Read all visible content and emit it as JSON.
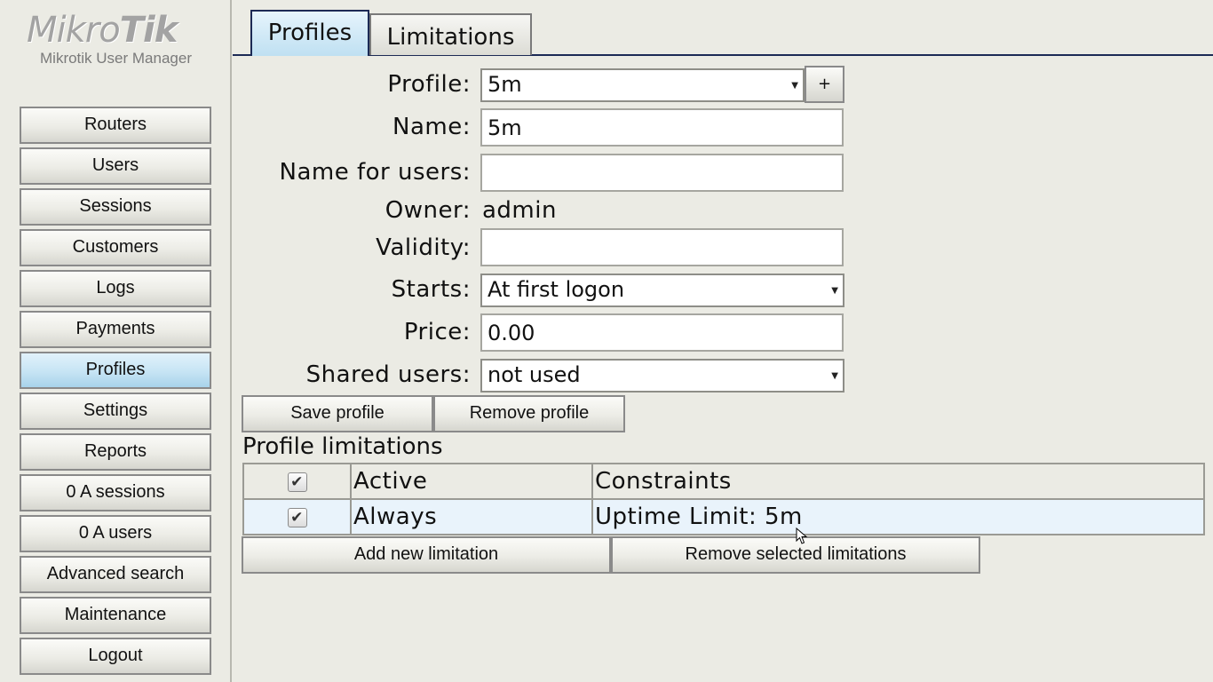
{
  "app": {
    "logo_text_a": "Mikro",
    "logo_text_b": "Tik",
    "subtitle": "Mikrotik User Manager"
  },
  "sidebar": {
    "items": [
      {
        "label": "Routers"
      },
      {
        "label": "Users"
      },
      {
        "label": "Sessions"
      },
      {
        "label": "Customers"
      },
      {
        "label": "Logs"
      },
      {
        "label": "Payments"
      },
      {
        "label": "Profiles",
        "active": true
      },
      {
        "label": "Settings"
      },
      {
        "label": "Reports"
      },
      {
        "label": "0 A sessions"
      },
      {
        "label": "0 A users"
      },
      {
        "label": "Advanced search"
      },
      {
        "label": "Maintenance"
      },
      {
        "label": "Logout"
      }
    ]
  },
  "tabs": [
    {
      "label": "Profiles",
      "active": true
    },
    {
      "label": "Limitations",
      "active": false
    }
  ],
  "form": {
    "profile_label": "Profile:",
    "profile_value": "5m",
    "add_label": "+",
    "name_label": "Name:",
    "name_value": "5m",
    "name_for_users_label": "Name for users:",
    "name_for_users_value": "",
    "owner_label": "Owner:",
    "owner_value": "admin",
    "validity_label": "Validity:",
    "validity_value": "",
    "starts_label": "Starts:",
    "starts_value": "At first logon",
    "price_label": "Price:",
    "price_value": "0.00",
    "shared_users_label": "Shared users:",
    "shared_users_value": "not used",
    "save_label": "Save profile",
    "remove_label": "Remove profile"
  },
  "limitations": {
    "title": "Profile limitations",
    "columns": [
      "",
      "Active",
      "Constraints"
    ],
    "header_checked": true,
    "rows": [
      {
        "checked": true,
        "active": "Always",
        "constraints": "Uptime Limit: 5m"
      }
    ],
    "add_label": "Add new limitation",
    "remove_label": "Remove selected limitations"
  },
  "icons": {
    "checkmark": "checkmark-icon",
    "dropdown": "dropdown-arrow-icon",
    "cursor": "mouse-cursor-icon"
  },
  "colors": {
    "background": "#ebebe4",
    "active_button": "#c6e4f4",
    "tab_line": "#1c2a55",
    "selected_row": "#e9f3fb"
  }
}
